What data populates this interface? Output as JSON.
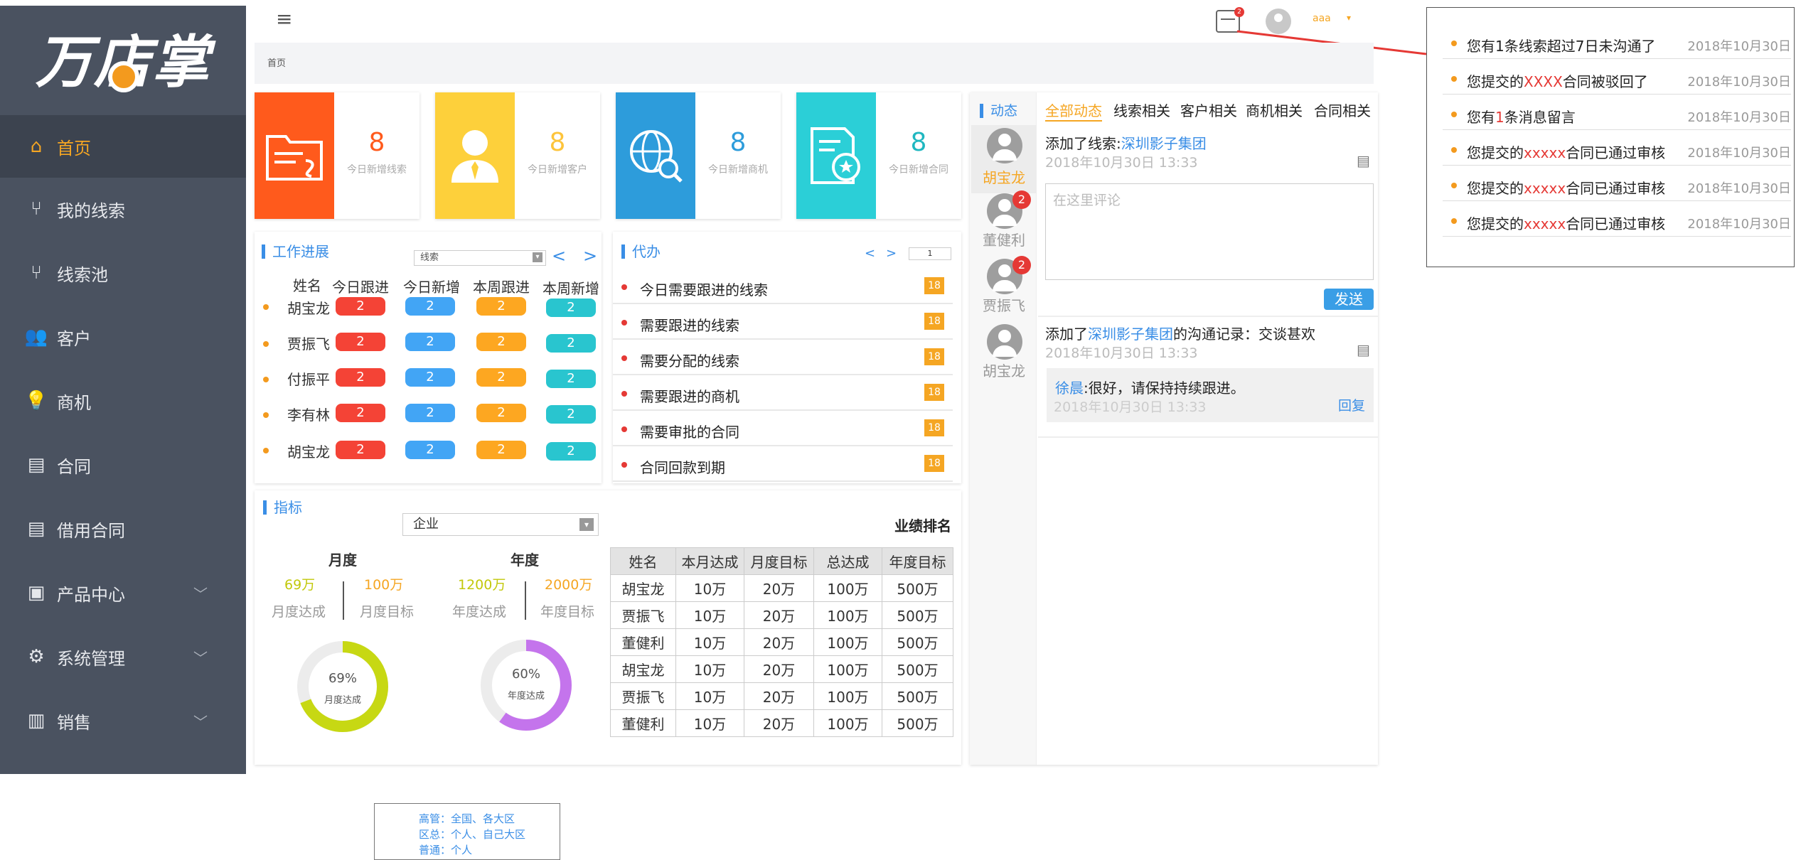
{
  "app": {
    "logo_text": "万店掌"
  },
  "sidebar": {
    "items": [
      {
        "label": "首页",
        "icon": "home-icon"
      },
      {
        "label": "我的线索",
        "icon": "clue-icon"
      },
      {
        "label": "线索池",
        "icon": "pool-icon"
      },
      {
        "label": "客户",
        "icon": "customer-icon"
      },
      {
        "label": "商机",
        "icon": "bulb-icon"
      },
      {
        "label": "合同",
        "icon": "document-icon"
      },
      {
        "label": "借用合同",
        "icon": "document-icon"
      },
      {
        "label": "产品中心",
        "icon": "box-icon"
      },
      {
        "label": "系统管理",
        "icon": "gear-icon"
      },
      {
        "label": "销售",
        "icon": "bar-chart-icon"
      }
    ]
  },
  "topbar": {
    "calendar_badge": "2",
    "user_name": "aaa",
    "breadcrumb": "首页"
  },
  "stats": [
    {
      "value": "8",
      "label": "今日新增线索",
      "color": "#ff5a1c"
    },
    {
      "value": "8",
      "label": "今日新增客户",
      "color": "#fdd03b"
    },
    {
      "value": "8",
      "label": "今日新增商机",
      "color": "#2d9cdb"
    },
    {
      "value": "8",
      "label": "今日新增合同",
      "color": "#2bcfd7"
    }
  ],
  "work_progress": {
    "title": "工作进展",
    "filter": "线索",
    "prev": "<",
    "next": ">",
    "headers": [
      "姓名",
      "今日跟进",
      "今日新增",
      "本周跟进",
      "本周新增"
    ],
    "rows": [
      {
        "name": "胡宝龙",
        "values": [
          "2",
          "2",
          "2",
          "2"
        ]
      },
      {
        "name": "贾振飞",
        "values": [
          "2",
          "2",
          "2",
          "2"
        ]
      },
      {
        "name": "付振平",
        "values": [
          "2",
          "2",
          "2",
          "2"
        ]
      },
      {
        "name": "李有林",
        "values": [
          "2",
          "2",
          "2",
          "2"
        ]
      },
      {
        "name": "胡宝龙",
        "values": [
          "2",
          "2",
          "2",
          "2"
        ]
      }
    ]
  },
  "todo": {
    "title": "代办",
    "prev": "<",
    "next": ">",
    "page": "1",
    "items": [
      {
        "label": "今日需要跟进的线索",
        "count": "18"
      },
      {
        "label": "需要跟进的线索",
        "count": "18"
      },
      {
        "label": "需要分配的线索",
        "count": "18"
      },
      {
        "label": "需要跟进的商机",
        "count": "18"
      },
      {
        "label": "需要审批的合同",
        "count": "18"
      },
      {
        "label": "合同回款到期",
        "count": "18"
      }
    ]
  },
  "metrics": {
    "title": "指标",
    "select": "企业",
    "monthly": {
      "title": "月度",
      "achieved": "69万",
      "target": "100万",
      "achieved_label": "月度达成",
      "target_label": "月度目标",
      "percent_text": "69%",
      "percent": 69,
      "ring_label": "月度达成"
    },
    "yearly": {
      "title": "年度",
      "achieved": "1200万",
      "target": "2000万",
      "achieved_label": "年度达成",
      "target_label": "年度目标",
      "percent_text": "60%",
      "percent": 60,
      "ring_label": "年度达成"
    }
  },
  "ranking": {
    "title": "业绩排名",
    "headers": [
      "姓名",
      "本月达成",
      "月度目标",
      "总达成",
      "年度目标"
    ],
    "rows": [
      [
        "胡宝龙",
        "10万",
        "20万",
        "100万",
        "500万"
      ],
      [
        "贾振飞",
        "10万",
        "20万",
        "100万",
        "500万"
      ],
      [
        "董健利",
        "10万",
        "20万",
        "100万",
        "500万"
      ],
      [
        "胡宝龙",
        "10万",
        "20万",
        "100万",
        "500万"
      ],
      [
        "贾振飞",
        "10万",
        "20万",
        "100万",
        "500万"
      ],
      [
        "董健利",
        "10万",
        "20万",
        "100万",
        "500万"
      ]
    ]
  },
  "activity": {
    "title": "动态",
    "tabs": [
      "全部动态",
      "线索相关",
      "客户相关",
      "商机相关",
      "合同相关"
    ],
    "users": [
      {
        "name": "胡宝龙",
        "badge": ""
      },
      {
        "name": "董健利",
        "badge": "2"
      },
      {
        "name": "贾振飞",
        "badge": "2"
      },
      {
        "name": "胡宝龙",
        "badge": ""
      }
    ],
    "post1": {
      "prefix": "添加了线索:",
      "link": "深圳影子集团",
      "time": "2018年10月30日 13:33"
    },
    "comment_placeholder": "在这里评论",
    "send": "发送",
    "post2": {
      "prefix": "添加了",
      "link": "深圳影子集团",
      "suffix": "的沟通记录：交谈甚欢",
      "time": "2018年10月30日 13:33"
    },
    "reply": {
      "user": "徐晨",
      "text": ":很好，请保持持续跟进。",
      "time": "2018年10月30日 13:33",
      "action": "回复"
    }
  },
  "notifications": [
    {
      "pre": "您有1条线索超过7日未沟通了",
      "hl": "",
      "post": "",
      "time": "2018年10月30日"
    },
    {
      "pre": "您提交的",
      "hl": "XXXX",
      "post": "合同被驳回了",
      "time": "2018年10月30日"
    },
    {
      "pre": "您有",
      "hl": "1",
      "post": "条消息留言",
      "time": "2018年10月30日"
    },
    {
      "pre": "您提交的",
      "hl": "xxxxx",
      "post": "合同已通过审核",
      "time": "2018年10月30日"
    },
    {
      "pre": "您提交的",
      "hl": "xxxxx",
      "post": "合同已通过审核",
      "time": "2018年10月30日"
    },
    {
      "pre": "您提交的",
      "hl": "xxxxx",
      "post": "合同已通过审核",
      "time": "2018年10月30日"
    }
  ],
  "role_note": [
    "高管：全国、各大区",
    "区总：个人、自己大区",
    "普通：个人"
  ]
}
